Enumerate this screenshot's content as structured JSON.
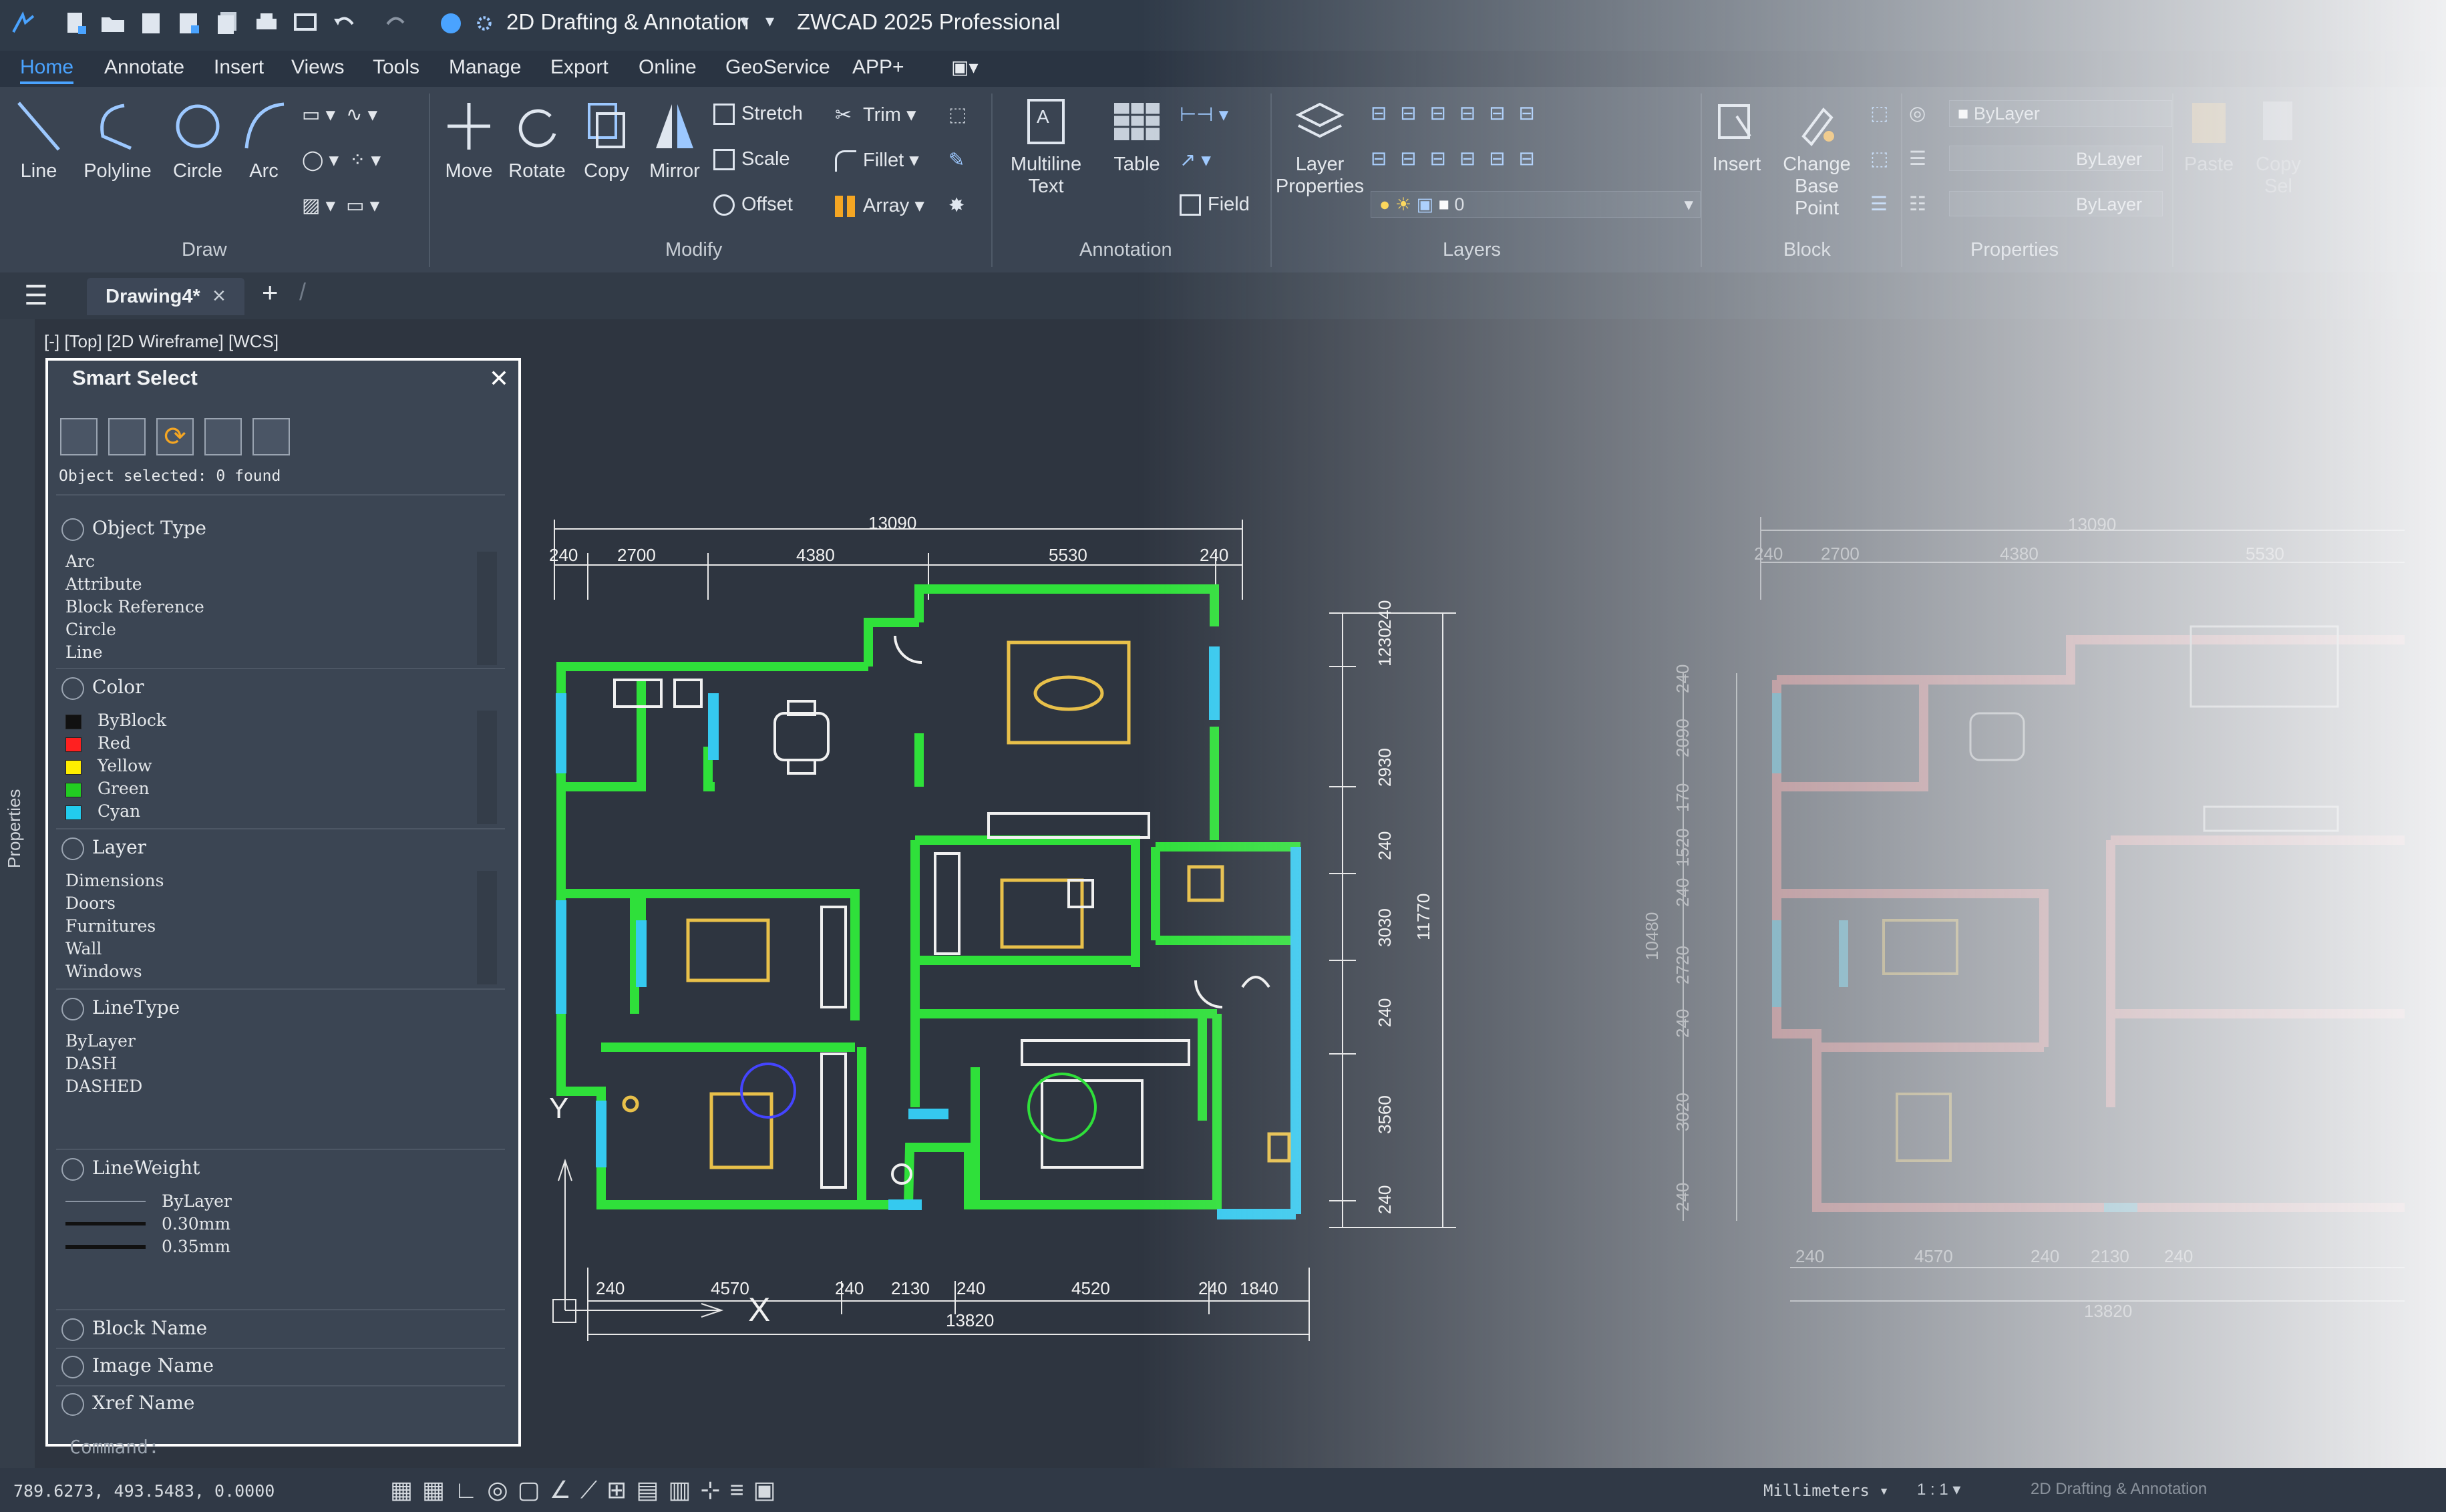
{
  "window": {
    "workspace": "2D Drafting & Annotation",
    "title": "ZWCAD 2025 Professional"
  },
  "menu": [
    "Home",
    "Annotate",
    "Insert",
    "Views",
    "Tools",
    "Manage",
    "Export",
    "Online",
    "GeoService",
    "APP+"
  ],
  "ribbon": {
    "draw": {
      "line": "Line",
      "polyline": "Polyline",
      "circle": "Circle",
      "arc": "Arc",
      "panel": "Draw"
    },
    "modify": {
      "move": "Move",
      "rotate": "Rotate",
      "copy": "Copy",
      "mirror": "Mirror",
      "stretch": "Stretch",
      "scale": "Scale",
      "offset": "Offset",
      "trim": "Trim",
      "fillet": "Fillet",
      "array": "Array",
      "panel": "Modify"
    },
    "annotation": {
      "mtext_line1": "Multiline",
      "mtext_line2": "Text",
      "table": "Table",
      "field": "Field",
      "panel": "Annotation"
    },
    "layers": {
      "layer_props_line1": "Layer",
      "layer_props_line2": "Properties",
      "current_layer": "0",
      "panel": "Layers"
    },
    "block": {
      "insert": "Insert",
      "change_line1": "Change",
      "change_line2": "Base Point",
      "panel": "Block"
    },
    "properties": {
      "color": "ByLayer",
      "linetype": "ByLayer",
      "lineweight": "ByLayer",
      "panel": "Properties"
    },
    "clipboard": {
      "paste": "Paste",
      "copy_line1": "Copy",
      "copy_line2": "Sel"
    }
  },
  "doc_tab": {
    "name": "Drawing4*"
  },
  "viewport_label": "[-] [Top] [2D Wireframe] [WCS]",
  "side_tab": "Properties",
  "smart_select": {
    "title": "Smart Select",
    "status": "Object selected: 0 found",
    "sections": {
      "object_type": {
        "label": "Object Type",
        "items": [
          "Arc",
          "Attribute",
          "Block Reference",
          "Circle",
          "Line"
        ]
      },
      "color": {
        "label": "Color",
        "items": [
          {
            "name": "ByBlock",
            "swatch": "#111111"
          },
          {
            "name": "Red",
            "swatch": "#ff2020"
          },
          {
            "name": "Yellow",
            "swatch": "#ffee00"
          },
          {
            "name": "Green",
            "swatch": "#22cc22"
          },
          {
            "name": "Cyan",
            "swatch": "#22ccee"
          }
        ]
      },
      "layer": {
        "label": "Layer",
        "items": [
          "Dimensions",
          "Doors",
          "Furnitures",
          "Wall",
          "Windows"
        ]
      },
      "linetype": {
        "label": "LineType",
        "items": [
          "ByLayer",
          "DASH",
          "DASHED"
        ]
      },
      "lineweight": {
        "label": "LineWeight",
        "items": [
          "ByLayer",
          "0.30mm",
          "0.35mm"
        ]
      },
      "block_name": {
        "label": "Block Name"
      },
      "image_name": {
        "label": "Image Name"
      },
      "xref_name": {
        "label": "Xref Name"
      }
    }
  },
  "drawing": {
    "dims_top_total": "13090",
    "dims_top": [
      "240",
      "2700",
      "4380",
      "5530",
      "240"
    ],
    "dims_bottom_total": "13820",
    "dims_bottom": [
      "240",
      "4570",
      "240",
      "2130",
      "240",
      "4520",
      "240",
      "1840"
    ],
    "dims_right": [
      "1230",
      "240",
      "2930",
      "240",
      "3030",
      "240",
      "3560",
      "240"
    ],
    "dims_right_total": "11770",
    "ghost_top_total": "13090",
    "ghost_top": [
      "240",
      "2700",
      "4380",
      "5530"
    ],
    "ghost_bottom_total": "13820",
    "ghost_bottom": [
      "240",
      "4570",
      "240",
      "2130",
      "240"
    ],
    "ghost_left_total": "10480",
    "ghost_left": [
      "240",
      "2090",
      "170",
      "1520",
      "240",
      "2720",
      "240",
      "3020",
      "240"
    ],
    "axis_x": "X",
    "axis_y": "Y",
    "colors": {
      "wall": "#2fe03a",
      "window": "#35c9ef",
      "furniture": "#e8c04a",
      "line": "#f0f0f0",
      "ghost_wall": "#f27a7a"
    }
  },
  "command": "Command:",
  "status": {
    "coords": "789.6273, 493.5483, 0.0000",
    "units": "Millimeters",
    "scale": "1 : 1",
    "workspace": "2D Drafting & Annotation"
  }
}
